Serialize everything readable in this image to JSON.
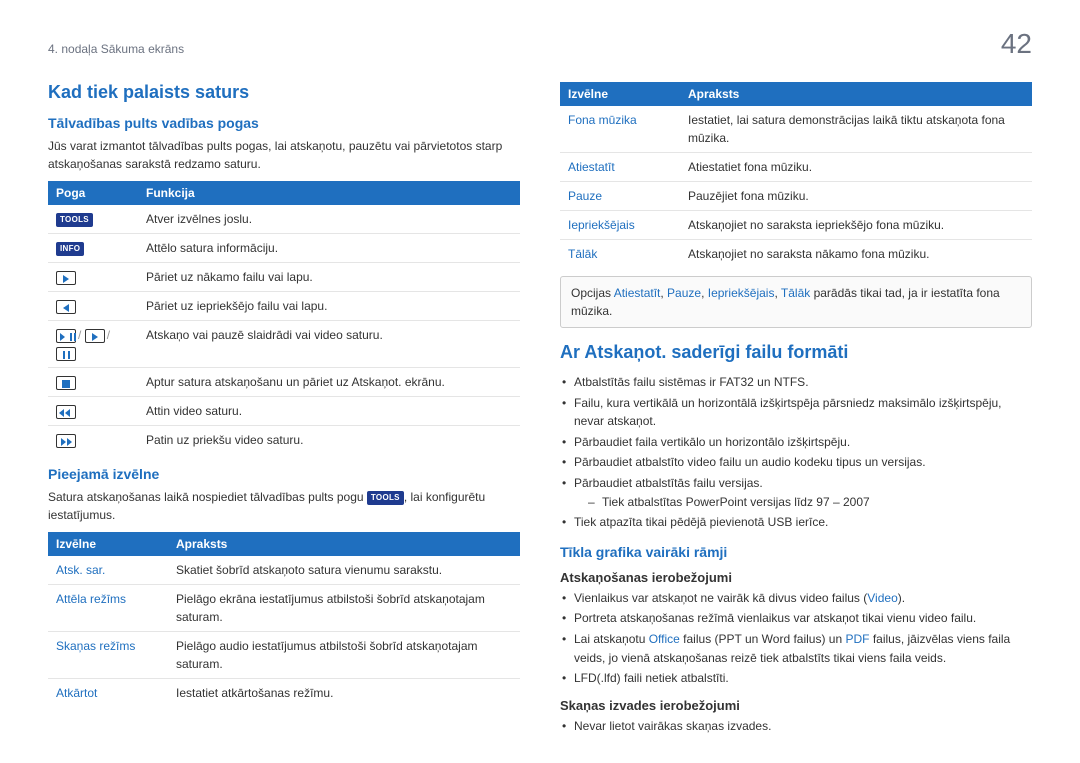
{
  "header": {
    "chapter": "4. nodaļa Sākuma ekrāns",
    "page": "42"
  },
  "left": {
    "h_main": "Kad tiek palaists saturs",
    "h_remote": "Tālvadības pults vadības pogas",
    "remote_intro": "Jūs varat izmantot tālvadības pults pogas, lai atskaņotu, pauzētu vai pārvietotos starp atskaņošanas sarakstā redzamo saturu.",
    "btn_table": {
      "th1": "Poga",
      "th2": "Funkcija",
      "rows": {
        "0": {
          "btn": "TOOLS",
          "fn": "Atver izvēlnes joslu."
        },
        "1": {
          "btn": "INFO",
          "fn": "Attēlo satura informāciju."
        },
        "2": {
          "fn": "Pāriet uz nākamo failu vai lapu."
        },
        "3": {
          "fn": "Pāriet uz iepriekšējo failu vai lapu."
        },
        "4": {
          "sep": "/",
          "fn": "Atskaņo vai pauzē slaidrādi vai video saturu."
        },
        "5": {
          "fn": "Aptur satura atskaņošanu un pāriet uz Atskaņot. ekrānu."
        },
        "6": {
          "fn": "Attin video saturu."
        },
        "7": {
          "fn": "Patin uz priekšu video saturu."
        }
      }
    },
    "h_menu": "Pieejamā izvēlne",
    "menu_intro_a": "Satura atskaņošanas laikā nospiediet tālvadības pults pogu ",
    "menu_intro_badge": "TOOLS",
    "menu_intro_b": ", lai konfigurētu iestatījumus.",
    "menu_table": {
      "th1": "Izvēlne",
      "th2": "Apraksts",
      "rows": {
        "0": {
          "m": "Atsk. sar.",
          "d": "Skatiet šobrīd atskaņoto satura vienumu sarakstu."
        },
        "1": {
          "m": "Attēla režīms",
          "d": "Pielāgo ekrāna iestatījumus atbilstoši šobrīd atskaņotajam saturam."
        },
        "2": {
          "m": "Skaņas režīms",
          "d": "Pielāgo audio iestatījumus atbilstoši šobrīd atskaņotajam saturam."
        },
        "3": {
          "m": "Atkārtot",
          "d": "Iestatiet atkārtošanas režīmu."
        }
      }
    }
  },
  "right": {
    "menu_table": {
      "th1": "Izvēlne",
      "th2": "Apraksts",
      "rows": {
        "0": {
          "m": "Fona mūzika",
          "d": "Iestatiet, lai satura demonstrācijas laikā tiktu atskaņota fona mūzika."
        },
        "1": {
          "m": "Atiestatīt",
          "d": "Atiestatiet fona mūziku."
        },
        "2": {
          "m": "Pauze",
          "d": "Pauzējiet fona mūziku."
        },
        "3": {
          "m": "Iepriekšējais",
          "d": "Atskaņojiet no saraksta iepriekšējo fona mūziku."
        },
        "4": {
          "m": "Tālāk",
          "d": "Atskaņojiet no saraksta nākamo fona mūziku."
        }
      }
    },
    "note": {
      "a": "Opcijas ",
      "o1": "Atiestatīt",
      "o2": "Pauze",
      "o3": "Iepriekšējais",
      "o4": "Tālāk",
      "b": " parādās tikai tad, ja ir iestatīta fona mūzika.",
      "comma": ", "
    },
    "h_compat": "Ar Atskaņot. saderīgi failu formāti",
    "compat_bullets": {
      "0": "Atbalstītās failu sistēmas ir FAT32 un NTFS.",
      "1": "Failu, kura vertikālā un horizontālā izšķirtspēja pārsniedz maksimālo izšķirtspēju, nevar atskaņot.",
      "2": "Pārbaudiet faila vertikālo un horizontālo izšķirtspēju.",
      "3": "Pārbaudiet atbalstīto video failu un audio kodeku tipus un versijas.",
      "4": "Pārbaudiet atbalstītās failu versijas.",
      "4a": "Tiek atbalstītas PowerPoint versijas līdz 97 – 2007",
      "5": "Tiek atpazīta tikai pēdējā pievienotā USB ierīce."
    },
    "h_multi": "Tīkla grafika vairāki rāmji",
    "h_play_lim": "Atskaņošanas ierobežojumi",
    "play_lim": {
      "0a": "Vienlaikus var atskaņot ne vairāk kā divus video failus (",
      "0b": "Video",
      "0c": ").",
      "1": "Portreta atskaņošanas režīmā vienlaikus var atskaņot tikai vienu video failu.",
      "2a": "Lai atskaņotu ",
      "2b": "Office",
      "2c": " failus (PPT un Word failus) un ",
      "2d": "PDF",
      "2e": " failus, jāizvēlas viens faila veids, jo vienā atskaņošanas reizē tiek atbalstīts tikai viens faila veids.",
      "3": "LFD(.lfd) faili netiek atbalstīti."
    },
    "h_sound_lim": "Skaņas izvades ierobežojumi",
    "sound_lim": {
      "0": "Nevar lietot vairākas skaņas izvades."
    }
  }
}
